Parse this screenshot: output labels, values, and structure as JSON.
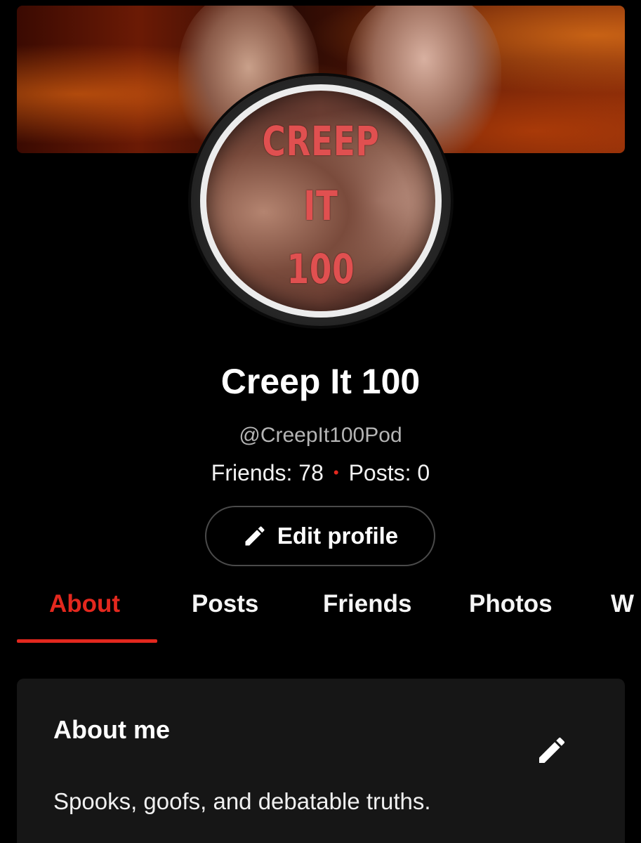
{
  "profile": {
    "name": "Creep It 100",
    "handle": "@CreepIt100Pod",
    "friends_label": "Friends: 78",
    "posts_label": "Posts: 0",
    "stats_separator": "•",
    "edit_button_label": "Edit profile",
    "avatar_text": [
      "CREEP",
      "IT",
      "100"
    ]
  },
  "tabs": [
    {
      "label": "About",
      "active": true
    },
    {
      "label": "Posts",
      "active": false
    },
    {
      "label": "Friends",
      "active": false
    },
    {
      "label": "Photos",
      "active": false
    },
    {
      "label": "W",
      "active": false
    }
  ],
  "about": {
    "title": "About me",
    "text": "Spooks, goofs, and debatable truths."
  },
  "colors": {
    "accent": "#e3281e",
    "background": "#000000",
    "card": "#161616",
    "avatar_text": "#e05050"
  },
  "icons": {
    "edit_button": "pencil-icon",
    "about_edit": "pencil-icon"
  }
}
